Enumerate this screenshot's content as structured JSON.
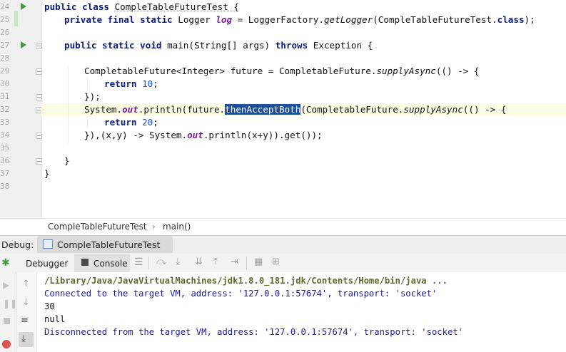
{
  "editor": {
    "line_numbers": [
      "24",
      "25",
      "26",
      "27",
      "28",
      "29",
      "30",
      "31",
      "32",
      "33",
      "34",
      "35",
      "36",
      "37",
      "38"
    ],
    "lines": {
      "l24": {
        "a": "public class ",
        "b": "CompleTableFutureTest {"
      },
      "l25": {
        "a": "private final static ",
        "b": "Logger ",
        "c": "log",
        "d": " = LoggerFactory.",
        "e": "getLogger",
        "f": "(CompleTableFutureTest.",
        "g": "class",
        "h": ");"
      },
      "l27": {
        "a": "public static void ",
        "b": "main(String[] args) ",
        "c": "throws ",
        "d": "Exception {"
      },
      "l29": {
        "a": "CompletableFuture<Integer> future = CompletableFuture.",
        "b": "supplyAsync",
        "c": "(() -> {"
      },
      "l30": {
        "a": "return ",
        "b": "10",
        "c": ";"
      },
      "l31": {
        "a": "});"
      },
      "l32": {
        "a": "System.",
        "b": "out",
        "c": ".println(future.",
        "d": "thenAcceptBoth",
        "e": "(CompletableFuture.",
        "f": "supplyAsync",
        "g": "(() -> {"
      },
      "l33": {
        "a": "return ",
        "b": "20",
        "c": ";"
      },
      "l34": {
        "a": "}),(x,y) -> System.",
        "b": "out",
        "c": ".println(x+y)).get());"
      },
      "l36": {
        "a": "}"
      },
      "l37": {
        "a": "}"
      }
    }
  },
  "breadcrumb": {
    "class_name": "CompleTableFutureTest",
    "separator": "›",
    "method": "main()"
  },
  "debug": {
    "label": "Debug:",
    "session_tab": "CompleTableFutureTest",
    "tabs": {
      "debugger": "Debugger",
      "console": "Console"
    }
  },
  "console": {
    "lines": [
      "/Library/Java/JavaVirtualMachines/jdk1.8.0_181.jdk/Contents/Home/bin/java ...",
      "Connected to the target VM, address: '127.0.0.1:57674', transport: 'socket'",
      "30",
      "null",
      "Disconnected from the target VM, address: '127.0.0.1:57674', transport: 'socket'"
    ]
  },
  "colors": {
    "keyword": "#0b1a80",
    "static_field": "#7a1c9e",
    "number": "#1750eb",
    "console_text": "#1a1aa6",
    "selection": "#1f4f9a"
  },
  "icons": [
    "run-gutter-icon",
    "bug-icon",
    "resume-icon",
    "pause-icon",
    "stop-icon",
    "console-icon",
    "menu-icon",
    "step-over-icon",
    "step-into-icon",
    "force-step-into-icon",
    "step-out-icon",
    "run-to-cursor-icon",
    "evaluate-icon",
    "table-icon",
    "up-arrow-icon",
    "down-arrow-icon",
    "soft-wrap-icon",
    "scroll-to-end-icon"
  ]
}
